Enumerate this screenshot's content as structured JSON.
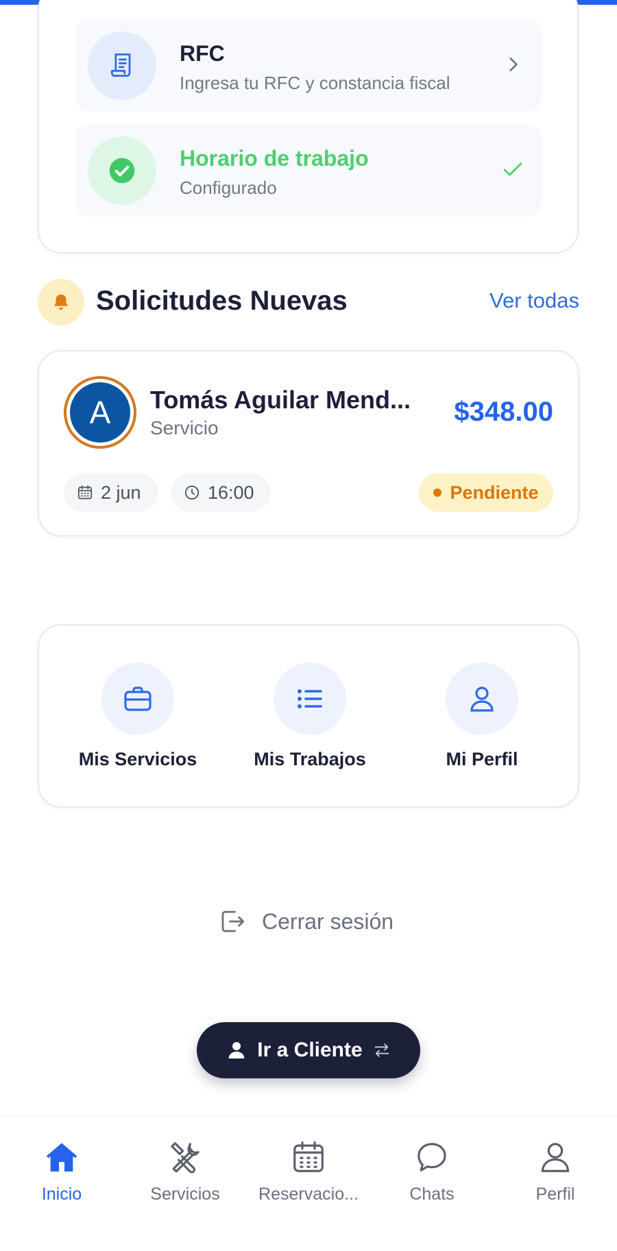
{
  "setup": {
    "rfc": {
      "title": "RFC",
      "subtitle": "Ingresa tu RFC y constancia fiscal"
    },
    "horario": {
      "title": "Horario de trabajo",
      "subtitle": "Configurado"
    }
  },
  "requests_section": {
    "title": "Solicitudes Nuevas",
    "see_all": "Ver todas"
  },
  "request": {
    "avatar_letter": "A",
    "name": "Tomás Aguilar Mend...",
    "service": "Servicio",
    "price": "$348.00",
    "date": "2 jun",
    "time": "16:00",
    "status": "Pendiente"
  },
  "quick_actions": [
    {
      "label": "Mis Servicios",
      "icon": "briefcase-icon"
    },
    {
      "label": "Mis Trabajos",
      "icon": "list-icon"
    },
    {
      "label": "Mi Perfil",
      "icon": "user-icon"
    }
  ],
  "logout_label": "Cerrar sesión",
  "switch_button": "Ir a Cliente",
  "tabs": [
    {
      "label": "Inicio",
      "icon": "home-icon",
      "active": true
    },
    {
      "label": "Servicios",
      "icon": "tools-icon",
      "active": false
    },
    {
      "label": "Reservacio...",
      "icon": "calendar-icon",
      "active": false
    },
    {
      "label": "Chats",
      "icon": "chat-icon",
      "active": false
    },
    {
      "label": "Perfil",
      "icon": "user-icon",
      "active": false
    }
  ],
  "colors": {
    "accent": "#2563eb",
    "success": "#4ccf6f",
    "pending": "#d97708",
    "dark": "#1c2039"
  }
}
